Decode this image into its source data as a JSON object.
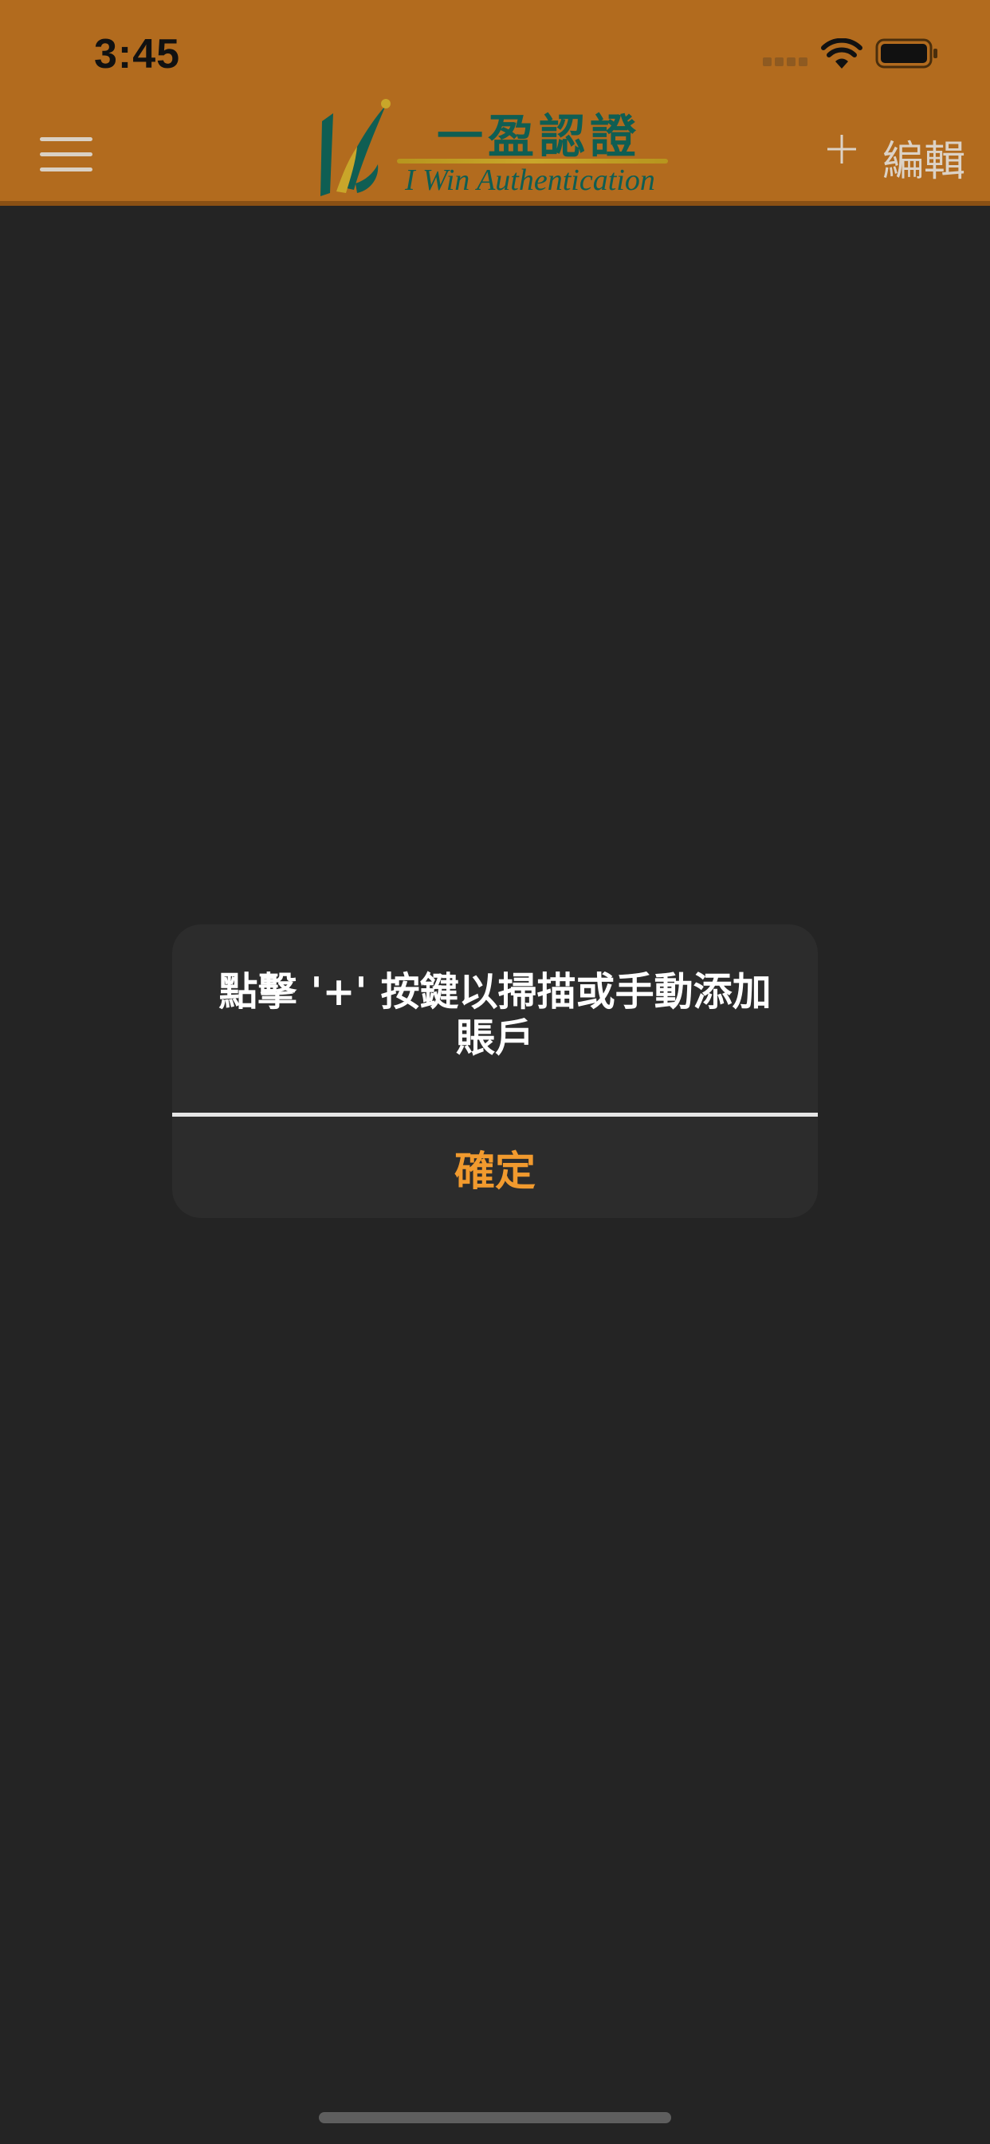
{
  "status_bar": {
    "time": "3:45",
    "icons": [
      "signal-icon",
      "wifi-icon",
      "battery-icon"
    ]
  },
  "nav": {
    "menu_icon": "hamburger-menu-icon",
    "logo": {
      "title_cn": "一盈認證",
      "title_en": "I Win Authentication"
    },
    "add_icon": "plus-icon",
    "edit_label": "編輯"
  },
  "alert": {
    "message_line1": "點擊 '+' 按鍵以掃描或手動添加",
    "message_line2": "賬戶",
    "ok_label": "確定"
  },
  "colors": {
    "header": "#b26b1e",
    "background": "#242424",
    "alert_background": "#2c2c2c",
    "accent": "#f19a2e",
    "logo_green": "#0f5e53"
  }
}
